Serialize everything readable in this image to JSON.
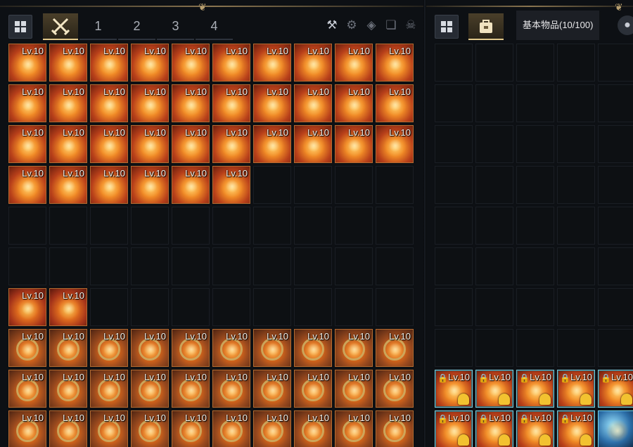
{
  "left_panel": {
    "tabs": {
      "active_icon": "crossed-swords-icon",
      "numbered": [
        "1",
        "2",
        "3",
        "4"
      ]
    },
    "toolbar_icons": [
      "sort-icon",
      "dismantle-icon",
      "cube-icon",
      "cards-icon",
      "skull-icon"
    ],
    "slots": [
      {
        "label": "Lv.10",
        "style": "s1"
      },
      {
        "label": "Lv.10",
        "style": "s1"
      },
      {
        "label": "Lv.10",
        "style": "s1"
      },
      {
        "label": "Lv.10",
        "style": "s1"
      },
      {
        "label": "Lv.10",
        "style": "s1"
      },
      {
        "label": "Lv.10",
        "style": "s1"
      },
      {
        "label": "Lv.10",
        "style": "s1"
      },
      {
        "label": "Lv.10",
        "style": "s1"
      },
      {
        "label": "Lv.10",
        "style": "s1"
      },
      {
        "label": "Lv.10",
        "style": "s1"
      },
      {
        "label": "Lv.10",
        "style": "s1"
      },
      {
        "label": "Lv.10",
        "style": "s1"
      },
      {
        "label": "Lv.10",
        "style": "s1"
      },
      {
        "label": "Lv.10",
        "style": "s1"
      },
      {
        "label": "Lv.10",
        "style": "s1"
      },
      {
        "label": "Lv.10",
        "style": "s1"
      },
      {
        "label": "Lv.10",
        "style": "s1"
      },
      {
        "label": "Lv.10",
        "style": "s1"
      },
      {
        "label": "Lv.10",
        "style": "s1"
      },
      {
        "label": "Lv.10",
        "style": "s1"
      },
      {
        "label": "Lv.10",
        "style": "s1"
      },
      {
        "label": "Lv.10",
        "style": "s1"
      },
      {
        "label": "Lv.10",
        "style": "s1"
      },
      {
        "label": "Lv.10",
        "style": "s1"
      },
      {
        "label": "Lv.10",
        "style": "s1"
      },
      {
        "label": "Lv.10",
        "style": "s1"
      },
      {
        "label": "Lv.10",
        "style": "s1"
      },
      {
        "label": "Lv.10",
        "style": "s1"
      },
      {
        "label": "Lv.10",
        "style": "s1"
      },
      {
        "label": "Lv.10",
        "style": "s1"
      },
      {
        "label": "Lv.10",
        "style": "s1"
      },
      {
        "label": "Lv.10",
        "style": "s1"
      },
      {
        "label": "Lv.10",
        "style": "s1"
      },
      {
        "label": "Lv.10",
        "style": "s1"
      },
      {
        "label": "Lv.10",
        "style": "s1"
      },
      {
        "label": "Lv.10",
        "style": "s1"
      },
      {
        "label": "",
        "style": "empty"
      },
      {
        "label": "",
        "style": "empty"
      },
      {
        "label": "",
        "style": "empty"
      },
      {
        "label": "",
        "style": "empty"
      },
      {
        "label": "",
        "style": "empty"
      },
      {
        "label": "",
        "style": "empty"
      },
      {
        "label": "",
        "style": "empty"
      },
      {
        "label": "",
        "style": "empty"
      },
      {
        "label": "",
        "style": "empty"
      },
      {
        "label": "",
        "style": "empty"
      },
      {
        "label": "",
        "style": "empty"
      },
      {
        "label": "",
        "style": "empty"
      },
      {
        "label": "",
        "style": "empty"
      },
      {
        "label": "",
        "style": "empty"
      },
      {
        "label": "",
        "style": "empty"
      },
      {
        "label": "",
        "style": "empty"
      },
      {
        "label": "",
        "style": "empty"
      },
      {
        "label": "",
        "style": "empty"
      },
      {
        "label": "",
        "style": "empty"
      },
      {
        "label": "",
        "style": "empty"
      },
      {
        "label": "",
        "style": "empty"
      },
      {
        "label": "",
        "style": "empty"
      },
      {
        "label": "",
        "style": "empty"
      },
      {
        "label": "",
        "style": "empty"
      },
      {
        "label": "Lv.10",
        "style": "s2"
      },
      {
        "label": "Lv.10",
        "style": "s2"
      },
      {
        "label": "",
        "style": "empty"
      },
      {
        "label": "",
        "style": "empty"
      },
      {
        "label": "",
        "style": "empty"
      },
      {
        "label": "",
        "style": "empty"
      },
      {
        "label": "",
        "style": "empty"
      },
      {
        "label": "",
        "style": "empty"
      },
      {
        "label": "",
        "style": "empty"
      },
      {
        "label": "",
        "style": "empty"
      },
      {
        "label": "Lv.10",
        "style": "s3"
      },
      {
        "label": "Lv.10",
        "style": "s3"
      },
      {
        "label": "Lv.10",
        "style": "s3"
      },
      {
        "label": "Lv.10",
        "style": "s3"
      },
      {
        "label": "Lv.10",
        "style": "s3"
      },
      {
        "label": "Lv.10",
        "style": "s3"
      },
      {
        "label": "Lv.10",
        "style": "s3"
      },
      {
        "label": "Lv.10",
        "style": "s3"
      },
      {
        "label": "Lv.10",
        "style": "s3"
      },
      {
        "label": "Lv.10",
        "style": "s3"
      },
      {
        "label": "Lv.10",
        "style": "s3"
      },
      {
        "label": "Lv.10",
        "style": "s3"
      },
      {
        "label": "Lv.10",
        "style": "s3"
      },
      {
        "label": "Lv.10",
        "style": "s3"
      },
      {
        "label": "Lv.10",
        "style": "s3"
      },
      {
        "label": "Lv.10",
        "style": "s3"
      },
      {
        "label": "Lv.10",
        "style": "s3"
      },
      {
        "label": "Lv.10",
        "style": "s3"
      },
      {
        "label": "Lv.10",
        "style": "s3"
      },
      {
        "label": "Lv.10",
        "style": "s3"
      },
      {
        "label": "Lv.10",
        "style": "s3"
      },
      {
        "label": "Lv.10",
        "style": "s3"
      },
      {
        "label": "Lv.10",
        "style": "s3"
      },
      {
        "label": "Lv.10",
        "style": "s3"
      },
      {
        "label": "Lv.10",
        "style": "s3"
      },
      {
        "label": "Lv.10",
        "style": "s3"
      },
      {
        "label": "Lv.10",
        "style": "s3"
      },
      {
        "label": "Lv.10",
        "style": "s3"
      },
      {
        "label": "Lv.10",
        "style": "s3"
      },
      {
        "label": "Lv.10",
        "style": "s3"
      }
    ]
  },
  "right_panel": {
    "tab_icon": "bag-icon",
    "tooltip": "基本物品(10/100)",
    "slots": [
      {
        "label": "",
        "style": "empty"
      },
      {
        "label": "",
        "style": "empty"
      },
      {
        "label": "",
        "style": "empty"
      },
      {
        "label": "",
        "style": "empty"
      },
      {
        "label": "",
        "style": "empty"
      },
      {
        "label": "",
        "style": "empty"
      },
      {
        "label": "",
        "style": "empty"
      },
      {
        "label": "",
        "style": "empty"
      },
      {
        "label": "",
        "style": "empty"
      },
      {
        "label": "",
        "style": "empty"
      },
      {
        "label": "",
        "style": "empty"
      },
      {
        "label": "",
        "style": "empty"
      },
      {
        "label": "",
        "style": "empty"
      },
      {
        "label": "",
        "style": "empty"
      },
      {
        "label": "",
        "style": "empty"
      },
      {
        "label": "",
        "style": "empty"
      },
      {
        "label": "",
        "style": "empty"
      },
      {
        "label": "",
        "style": "empty"
      },
      {
        "label": "",
        "style": "empty"
      },
      {
        "label": "",
        "style": "empty"
      },
      {
        "label": "",
        "style": "empty"
      },
      {
        "label": "",
        "style": "empty"
      },
      {
        "label": "",
        "style": "empty"
      },
      {
        "label": "",
        "style": "empty"
      },
      {
        "label": "",
        "style": "empty"
      },
      {
        "label": "",
        "style": "empty"
      },
      {
        "label": "",
        "style": "empty"
      },
      {
        "label": "",
        "style": "empty"
      },
      {
        "label": "",
        "style": "empty"
      },
      {
        "label": "",
        "style": "empty"
      },
      {
        "label": "",
        "style": "empty"
      },
      {
        "label": "",
        "style": "empty"
      },
      {
        "label": "",
        "style": "empty"
      },
      {
        "label": "",
        "style": "empty"
      },
      {
        "label": "",
        "style": "empty"
      },
      {
        "label": "",
        "style": "empty"
      },
      {
        "label": "",
        "style": "empty"
      },
      {
        "label": "",
        "style": "empty"
      },
      {
        "label": "",
        "style": "empty"
      },
      {
        "label": "",
        "style": "empty"
      },
      {
        "label": "Lv.10",
        "style": "s1",
        "locked": true
      },
      {
        "label": "Lv.10",
        "style": "s1",
        "locked": true
      },
      {
        "label": "Lv.10",
        "style": "s1",
        "locked": true
      },
      {
        "label": "Lv.10",
        "style": "s1",
        "locked": true
      },
      {
        "label": "Lv.10",
        "style": "s1",
        "locked": true
      },
      {
        "label": "Lv.10",
        "style": "s1",
        "locked": true
      },
      {
        "label": "Lv.10",
        "style": "s1",
        "locked": true
      },
      {
        "label": "Lv.10",
        "style": "s1",
        "locked": true
      },
      {
        "label": "Lv.10",
        "style": "s1",
        "locked": true
      },
      {
        "label": "",
        "style": "gem"
      }
    ]
  }
}
